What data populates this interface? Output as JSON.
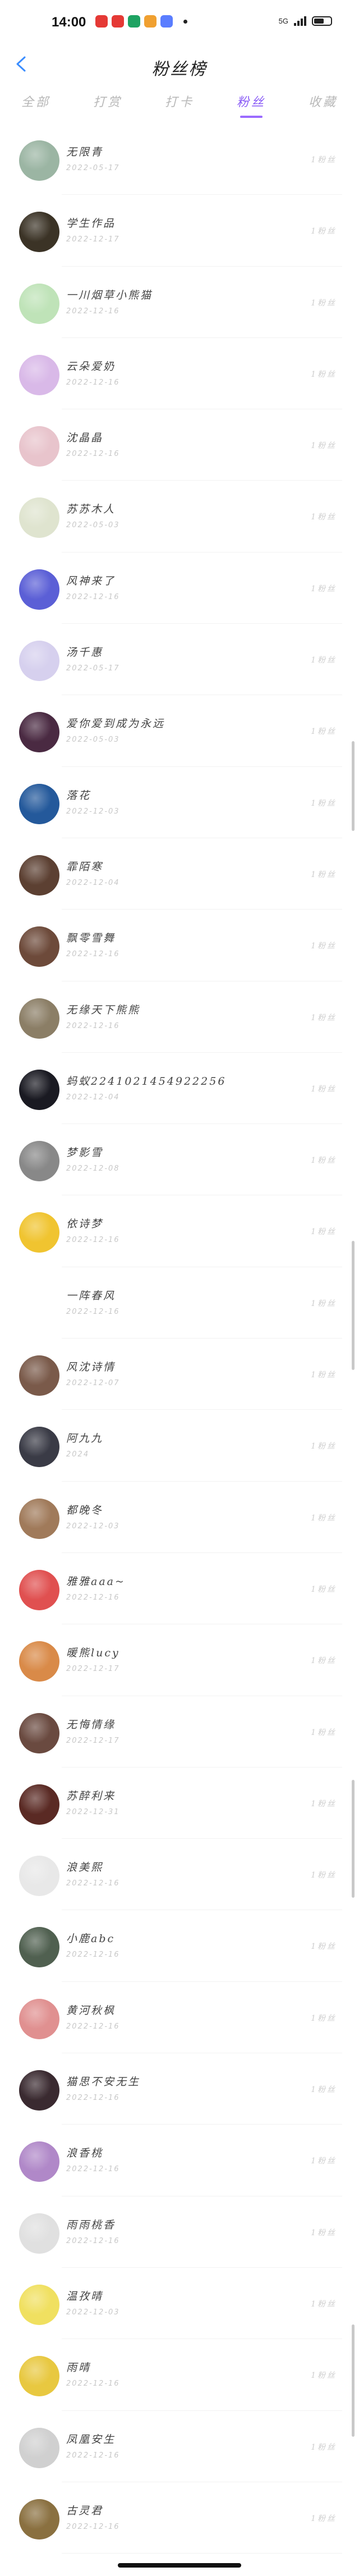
{
  "status": {
    "time": "14:00",
    "apps": [
      "#e53935",
      "#e53935",
      "#1ea362",
      "#f0a030",
      "#5a7dff"
    ],
    "right_text": "5G",
    "battery_label": "",
    "battery_fill": 0.6
  },
  "nav": {
    "title": "粉丝榜"
  },
  "tabs": [
    {
      "label": "全部",
      "active": false
    },
    {
      "label": "打赏",
      "active": false
    },
    {
      "label": "打卡",
      "active": false
    },
    {
      "label": "粉丝",
      "active": true
    },
    {
      "label": "收藏",
      "active": false
    }
  ],
  "rows": [
    {
      "name": "无限青",
      "date": "2022-05-17",
      "follow": "1粉丝",
      "avatar": "#9bb5a3"
    },
    {
      "name": "学生作品",
      "date": "2022-12-17",
      "follow": "1粉丝",
      "avatar": "#3b3326"
    },
    {
      "name": "一川烟草小熊猫",
      "date": "2022-12-16",
      "follow": "1粉丝",
      "avatar": "#bfe3b8"
    },
    {
      "name": "云朵爱奶",
      "date": "2022-12-16",
      "follow": "1粉丝",
      "avatar": "#d9b9e8"
    },
    {
      "name": "沈晶晶",
      "date": "2022-12-16",
      "follow": "1粉丝",
      "avatar": "#e8c4cc"
    },
    {
      "name": "苏苏木人",
      "date": "2022-05-03",
      "follow": "1粉丝",
      "avatar": "#dfe4cf"
    },
    {
      "name": "风神来了",
      "date": "2022-12-16",
      "follow": "1粉丝",
      "avatar": "#5b5fd6"
    },
    {
      "name": "汤千惠",
      "date": "2022-05-17",
      "follow": "1粉丝",
      "avatar": "#d6d0ee"
    },
    {
      "name": "爱你爱到成为永远",
      "date": "2022-05-03",
      "follow": "1粉丝",
      "avatar": "#4a2a42"
    },
    {
      "name": "落花",
      "date": "2022-12-03",
      "follow": "1粉丝",
      "avatar": "#24599b"
    },
    {
      "name": "霏陌寒",
      "date": "2022-12-04",
      "follow": "1粉丝",
      "avatar": "#5c4032"
    },
    {
      "name": "飘零雪舞",
      "date": "2022-12-16",
      "follow": "1粉丝",
      "avatar": "#6d4a3a"
    },
    {
      "name": "无缘天下熊熊",
      "date": "2022-12-16",
      "follow": "1粉丝",
      "avatar": "#8b7e66"
    },
    {
      "name": "蚂蚁2241021454922256",
      "date": "2022-12-04",
      "follow": "1粉丝",
      "avatar": "#1a1a22"
    },
    {
      "name": "梦影雪",
      "date": "2022-12-08",
      "follow": "1粉丝",
      "avatar": "#888888"
    },
    {
      "name": "依诗梦",
      "date": "2022-12-16",
      "follow": "1粉丝",
      "avatar": "#f0c430"
    },
    {
      "name": "一阵春风",
      "date": "2022-12-16",
      "follow": "1粉丝",
      "avatar": "#ffffff"
    },
    {
      "name": "风沈诗情",
      "date": "2022-12-07",
      "follow": "1粉丝",
      "avatar": "#7a5a4a"
    },
    {
      "name": "阿九九",
      "date": "2024",
      "follow": "1粉丝",
      "avatar": "#3a3b46"
    },
    {
      "name": "都晚冬",
      "date": "2022-12-03",
      "follow": "1粉丝",
      "avatar": "#a07a5a"
    },
    {
      "name": "雅雅aaa~",
      "date": "2022-12-16",
      "follow": "1粉丝",
      "avatar": "#e05050"
    },
    {
      "name": "暖熊lucy",
      "date": "2022-12-17",
      "follow": "1粉丝",
      "avatar": "#d98a48"
    },
    {
      "name": "无悔情缘",
      "date": "2022-12-17",
      "follow": "1粉丝",
      "avatar": "#6a4a40"
    },
    {
      "name": "苏醉利来",
      "date": "2022-12-31",
      "follow": "1粉丝",
      "avatar": "#5a2a24"
    },
    {
      "name": "浪美熙",
      "date": "2022-12-16",
      "follow": "1粉丝",
      "avatar": "#e8e8e8"
    },
    {
      "name": "小鹿abc",
      "date": "2022-12-16",
      "follow": "1粉丝",
      "avatar": "#506050"
    },
    {
      "name": "黄河秋枫",
      "date": "2022-12-16",
      "follow": "1粉丝",
      "avatar": "#e09090"
    },
    {
      "name": "猫思不安无生",
      "date": "2022-12-16",
      "follow": "1粉丝",
      "avatar": "#3a2a30"
    },
    {
      "name": "浪香桃",
      "date": "2022-12-16",
      "follow": "1粉丝",
      "avatar": "#b088c8"
    },
    {
      "name": "雨雨桃香",
      "date": "2022-12-16",
      "follow": "1粉丝",
      "avatar": "#e0e0e0"
    },
    {
      "name": "温孜晴",
      "date": "2022-12-03",
      "follow": "1粉丝",
      "avatar": "#f0e060"
    },
    {
      "name": "雨晴",
      "date": "2022-12-16",
      "follow": "1粉丝",
      "avatar": "#e8c840"
    },
    {
      "name": "凤凰安生",
      "date": "2022-12-16",
      "follow": "1粉丝",
      "avatar": "#d0d0d0"
    },
    {
      "name": "古灵君",
      "date": "2022-12-16",
      "follow": "1粉丝",
      "avatar": "#8a7040"
    }
  ]
}
